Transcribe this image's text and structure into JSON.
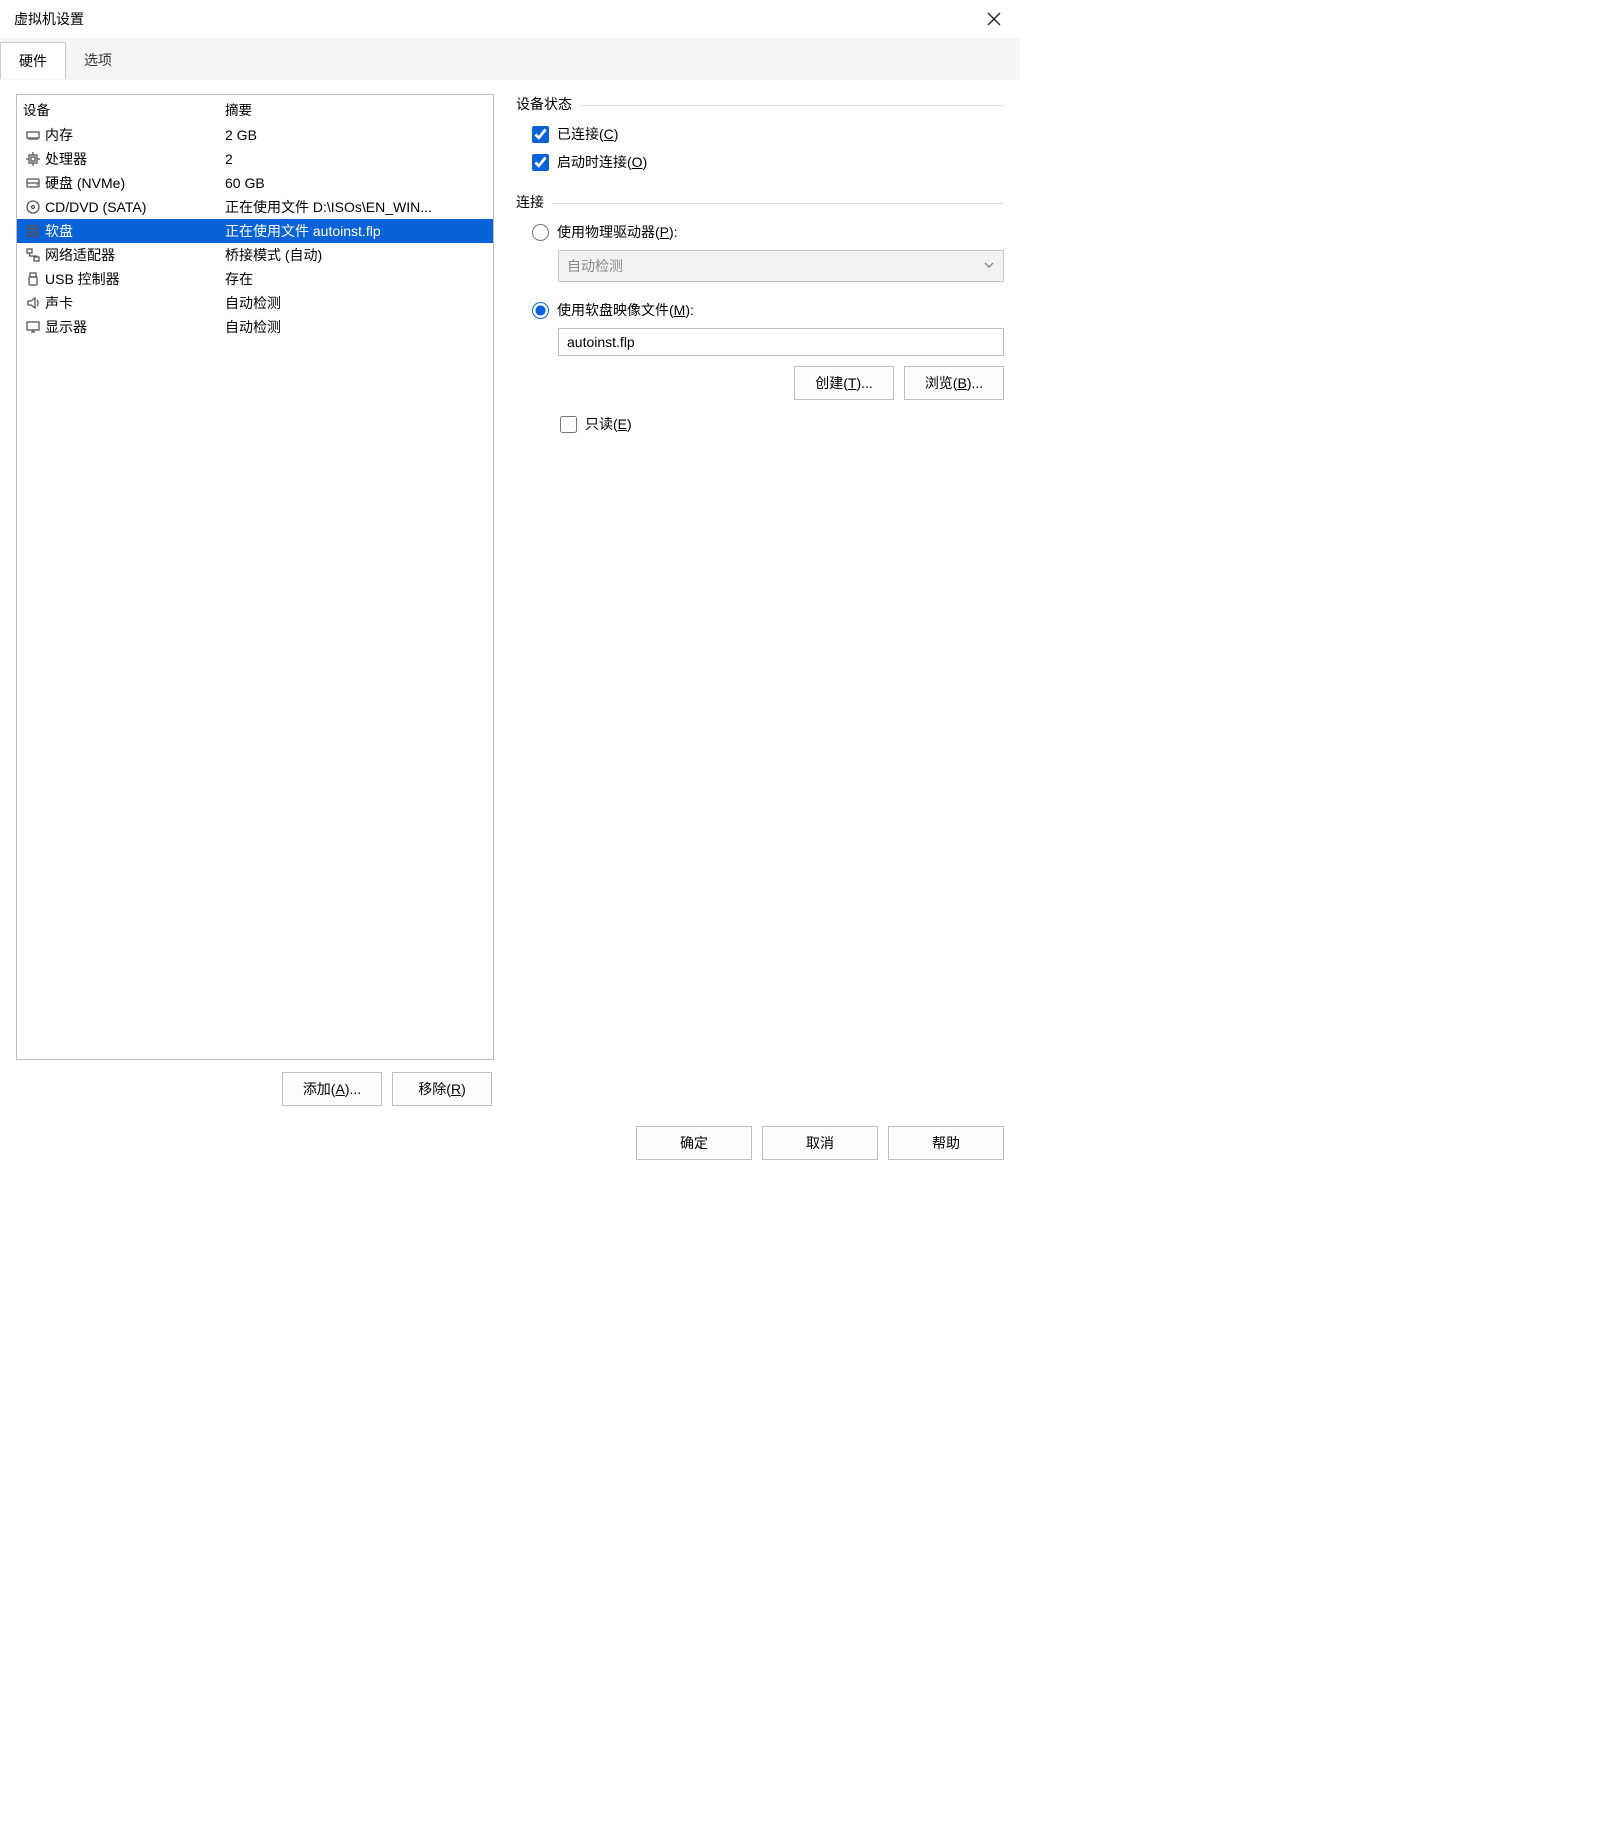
{
  "window_title": "虚拟机设置",
  "tabs": {
    "hardware": "硬件",
    "options": "选项"
  },
  "hw_header": {
    "device": "设备",
    "summary": "摘要"
  },
  "hw": [
    {
      "icon": "memory-icon",
      "name": "内存",
      "summary": "2 GB"
    },
    {
      "icon": "cpu-icon",
      "name": "处理器",
      "summary": "2"
    },
    {
      "icon": "disk-icon",
      "name": "硬盘 (NVMe)",
      "summary": "60 GB"
    },
    {
      "icon": "cd-icon",
      "name": "CD/DVD (SATA)",
      "summary": "正在使用文件 D:\\ISOs\\EN_WIN..."
    },
    {
      "icon": "floppy-icon",
      "name": "软盘",
      "summary": "正在使用文件 autoinst.flp",
      "selected": true
    },
    {
      "icon": "network-icon",
      "name": "网络适配器",
      "summary": "桥接模式 (自动)"
    },
    {
      "icon": "usb-icon",
      "name": "USB 控制器",
      "summary": "存在"
    },
    {
      "icon": "sound-icon",
      "name": "声卡",
      "summary": "自动检测"
    },
    {
      "icon": "display-icon",
      "name": "显示器",
      "summary": "自动检测"
    }
  ],
  "list_buttons": {
    "add": "添加(A)...",
    "remove": "移除(R)"
  },
  "status_group": {
    "title": "设备状态",
    "connected": "已连接(C)",
    "connect_on_power": "启动时连接(O)"
  },
  "connection_group": {
    "title": "连接",
    "use_physical": "使用物理驱动器(P):",
    "physical_value": "自动检测",
    "use_image": "使用软盘映像文件(M):",
    "image_value": "autoinst.flp",
    "create_btn": "创建(T)...",
    "browse_btn": "浏览(B)...",
    "readonly": "只读(E)"
  },
  "footer": {
    "ok": "确定",
    "cancel": "取消",
    "help": "帮助"
  }
}
